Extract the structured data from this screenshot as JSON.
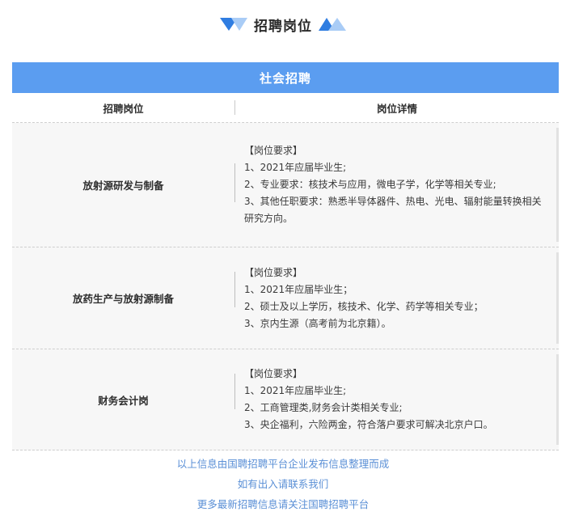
{
  "header": {
    "title": "招聘岗位"
  },
  "table": {
    "banner": "社会招聘",
    "columns": {
      "position": "招聘岗位",
      "details": "岗位详情"
    },
    "rows": [
      {
        "position": "放射源研发与制备",
        "requirements_title": "【岗位要求】",
        "lines": [
          "1、2021年应届毕业生;",
          "2、专业要求：核技术与应用，微电子学，化学等相关专业;",
          "3、其他任职要求：熟悉半导体器件、热电、光电、辐射能量转换相关研究方向。"
        ]
      },
      {
        "position": "放药生产与放射源制备",
        "requirements_title": "【岗位要求】",
        "lines": [
          "1、2021年应届毕业生；",
          "2、硕士及以上学历，核技术、化学、药学等相关专业；",
          "3、京内生源（高考前为北京籍）。"
        ]
      },
      {
        "position": "财务会计岗",
        "requirements_title": "【岗位要求】",
        "lines": [
          "1、2021年应届毕业生;",
          "2、工商管理类,财务会计类相关专业;",
          "3、央企福利，六险两金，符合落户要求可解决北京户口。"
        ]
      }
    ]
  },
  "footer": {
    "line1": "以上信息由国聘招聘平台企业发布信息整理而成",
    "line2": "如有出入请联系我们",
    "line3": "更多最新招聘信息请关注国聘招聘平台"
  },
  "colors": {
    "accent": "#5b9df0",
    "footer_text": "#5a8fd6"
  },
  "icons": {
    "left": "double-triangle-down-icon",
    "right": "double-triangle-up-icon"
  }
}
